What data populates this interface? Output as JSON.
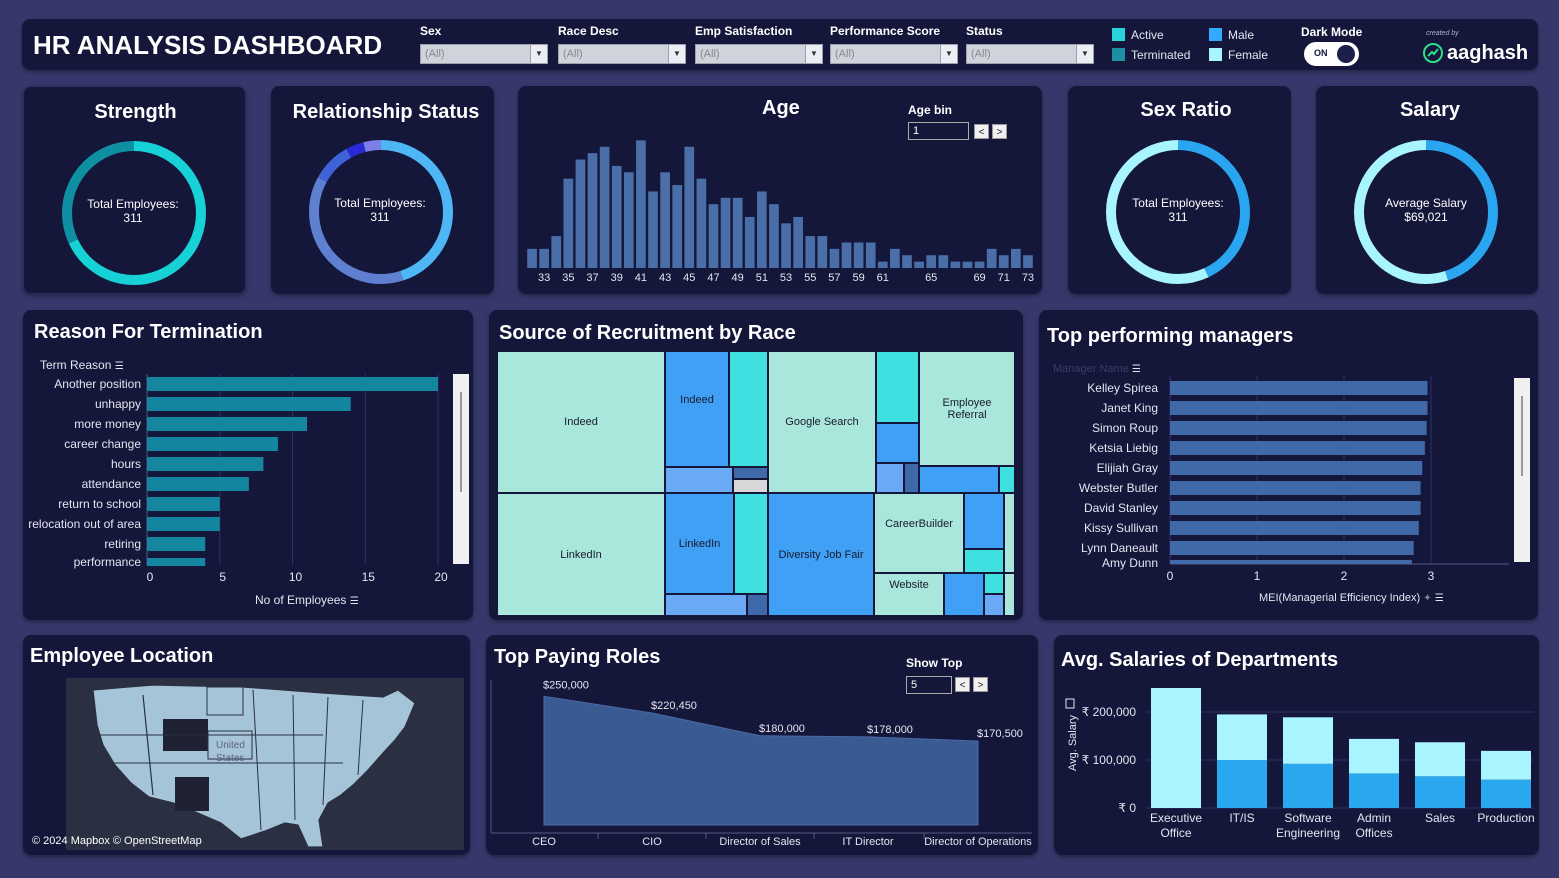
{
  "header": {
    "title": "HR ANALYSIS DASHBOARD",
    "filters": [
      {
        "label": "Sex",
        "value": "(All)"
      },
      {
        "label": "Race Desc",
        "value": "(All)"
      },
      {
        "label": "Emp Satisfaction",
        "value": "(All)"
      },
      {
        "label": "Performance Score",
        "value": "(All)"
      },
      {
        "label": "Status",
        "value": "(All)"
      }
    ],
    "legend": [
      {
        "label": "Active",
        "color": "#29d3dd"
      },
      {
        "label": "Terminated",
        "color": "#1b8fa3"
      },
      {
        "label": "Male",
        "color": "#33aaff"
      },
      {
        "label": "Female",
        "color": "#a8f4ff"
      }
    ],
    "dark_mode_label": "Dark Mode",
    "toggle_text": "ON",
    "created_by": "created by",
    "brand": "aaghash"
  },
  "strength": {
    "title": "Strength",
    "center_label": "Total Employees:",
    "center_value": "311",
    "segments": [
      {
        "value": 0.68,
        "color": "#16d1d6"
      },
      {
        "value": 0.32,
        "color": "#0f8fa2"
      }
    ]
  },
  "relationship": {
    "title": "Relationship Status",
    "center_label": "Total Employees:",
    "center_value": "311",
    "segments": [
      {
        "value": 0.45,
        "color": "#4fb6f5"
      },
      {
        "value": 0.38,
        "color": "#5f7fd0"
      },
      {
        "value": 0.09,
        "color": "#3f62d9"
      },
      {
        "value": 0.04,
        "color": "#2a2ad6"
      },
      {
        "value": 0.04,
        "color": "#7b7fe6"
      }
    ]
  },
  "age": {
    "title": "Age",
    "bin_label": "Age bin",
    "bin_value": "1",
    "prev": "<",
    "next": ">",
    "chart_data": {
      "type": "bar",
      "x": [
        32,
        33,
        34,
        35,
        36,
        37,
        38,
        39,
        40,
        41,
        42,
        43,
        44,
        45,
        46,
        47,
        48,
        49,
        50,
        51,
        52,
        53,
        54,
        55,
        56,
        57,
        58,
        59,
        60,
        61,
        62,
        63,
        64,
        65,
        66,
        67,
        68,
        69,
        70,
        71,
        72,
        73
      ],
      "values": [
        3,
        3,
        5,
        14,
        17,
        18,
        19,
        16,
        15,
        20,
        12,
        15,
        13,
        19,
        14,
        10,
        11,
        11,
        8,
        12,
        10,
        7,
        8,
        5,
        5,
        3,
        4,
        4,
        4,
        1,
        3,
        2,
        1,
        2,
        2,
        1,
        1,
        1,
        3,
        2,
        3,
        2
      ],
      "tick_labels": [
        "33",
        "35",
        "37",
        "39",
        "41",
        "43",
        "45",
        "47",
        "49",
        "51",
        "53",
        "55",
        "57",
        "59",
        "61",
        "65",
        "69",
        "71",
        "73"
      ],
      "color": "#4a6fa8"
    }
  },
  "sex_ratio": {
    "title": "Sex Ratio",
    "center_label": "Total Employees:",
    "center_value": "311",
    "segments": [
      {
        "value": 0.43,
        "color": "#2aa5f0"
      },
      {
        "value": 0.57,
        "color": "#a8f4ff"
      }
    ]
  },
  "salary": {
    "title": "Salary",
    "center_label": "Average Salary",
    "center_value": "$69,021",
    "segments": [
      {
        "value": 0.45,
        "color": "#2aa5f0"
      },
      {
        "value": 0.55,
        "color": "#a8f4ff"
      }
    ]
  },
  "termination": {
    "title": "Reason For Termination",
    "field_label": "Term Reason",
    "axis_label": "No of Employees",
    "chart_data": {
      "type": "bar",
      "orientation": "horizontal",
      "categories": [
        "Another position",
        "unhappy",
        "more money",
        "career change",
        "hours",
        "attendance",
        "return to school",
        "relocation out of area",
        "retiring",
        "performance"
      ],
      "values": [
        20,
        14,
        11,
        9,
        8,
        7,
        5,
        5,
        4,
        4
      ],
      "xlim": [
        0,
        22
      ],
      "ticks": [
        "0",
        "5",
        "10",
        "15",
        "20"
      ],
      "color": "#1586a0"
    }
  },
  "recruitment": {
    "title": "Source of Recruitment by Race",
    "cells": [
      {
        "label": "Indeed",
        "color": "#a9e7dc"
      },
      {
        "label": "Indeed",
        "color": "#3fa0f5"
      },
      {
        "label": "Google Search",
        "color": "#a9e7dc"
      },
      {
        "label": "Employee Referral",
        "color": "#a9e7dc"
      },
      {
        "label": "LinkedIn",
        "color": "#a9e7dc"
      },
      {
        "label": "LinkedIn",
        "color": "#3fa0f5"
      },
      {
        "label": "Diversity Job Fair",
        "color": "#3fa0f5"
      },
      {
        "label": "CareerBuilder",
        "color": "#a9e7dc"
      },
      {
        "label": "Website",
        "color": "#a9e7dc"
      }
    ]
  },
  "managers": {
    "title": "Top performing managers",
    "field_label": "Manager Name",
    "axis_label": "MEI(Managerial Efficiency Index)",
    "chart_data": {
      "type": "bar",
      "orientation": "horizontal",
      "categories": [
        "Kelley Spirea",
        "Janet King",
        "Simon Roup",
        "Ketsia Liebig",
        "Elijiah Gray",
        "Webster Butler",
        "David Stanley",
        "Kissy Sullivan",
        "Lynn Daneault",
        "Amy Dunn"
      ],
      "values": [
        2.96,
        2.96,
        2.95,
        2.93,
        2.9,
        2.88,
        2.88,
        2.86,
        2.8,
        2.78
      ],
      "xlim": [
        0,
        3.9
      ],
      "ticks": [
        "0",
        "1",
        "2",
        "3"
      ],
      "color": "#3f69a8"
    }
  },
  "location": {
    "title": "Employee Location",
    "map_label_1": "United",
    "map_label_2": "States",
    "attribution": "© 2024 Mapbox © OpenStreetMap"
  },
  "top_roles": {
    "title": "Top Paying Roles",
    "show_top_label": "Show Top",
    "show_top_value": "5",
    "prev": "<",
    "next": ">",
    "chart_data": {
      "type": "area",
      "categories": [
        "CEO",
        "CIO",
        "Director of Sales",
        "IT Director",
        "Director of Operations"
      ],
      "values": [
        250000,
        220450,
        180000,
        178000,
        170500
      ],
      "labels": [
        "$250,000",
        "$220,450",
        "$180,000",
        "$178,000",
        "$170,500"
      ],
      "ylim": [
        0,
        280000
      ],
      "color": "#3a5a92"
    }
  },
  "dept_salaries": {
    "title": "Avg. Salaries of Departments",
    "ylabel": "Avg. Salary",
    "chart_data": {
      "type": "bar",
      "stacked": true,
      "categories": [
        "Executive Office",
        "IT/IS",
        "Software Engineering",
        "Admin Offices",
        "Sales",
        "Production"
      ],
      "series": [
        {
          "values": [
            0,
            100000,
            92000,
            72000,
            66000,
            59000
          ],
          "color": "#29a8f0"
        },
        {
          "values": [
            250000,
            95000,
            97000,
            72000,
            71000,
            60000
          ],
          "color": "#a8f4ff"
        }
      ],
      "ylim": [
        0,
        250000
      ],
      "ticks": [
        "₹ 0",
        "₹ 100,000",
        "₹ 200,000"
      ],
      "tick_values": [
        0,
        100000,
        200000
      ]
    }
  }
}
